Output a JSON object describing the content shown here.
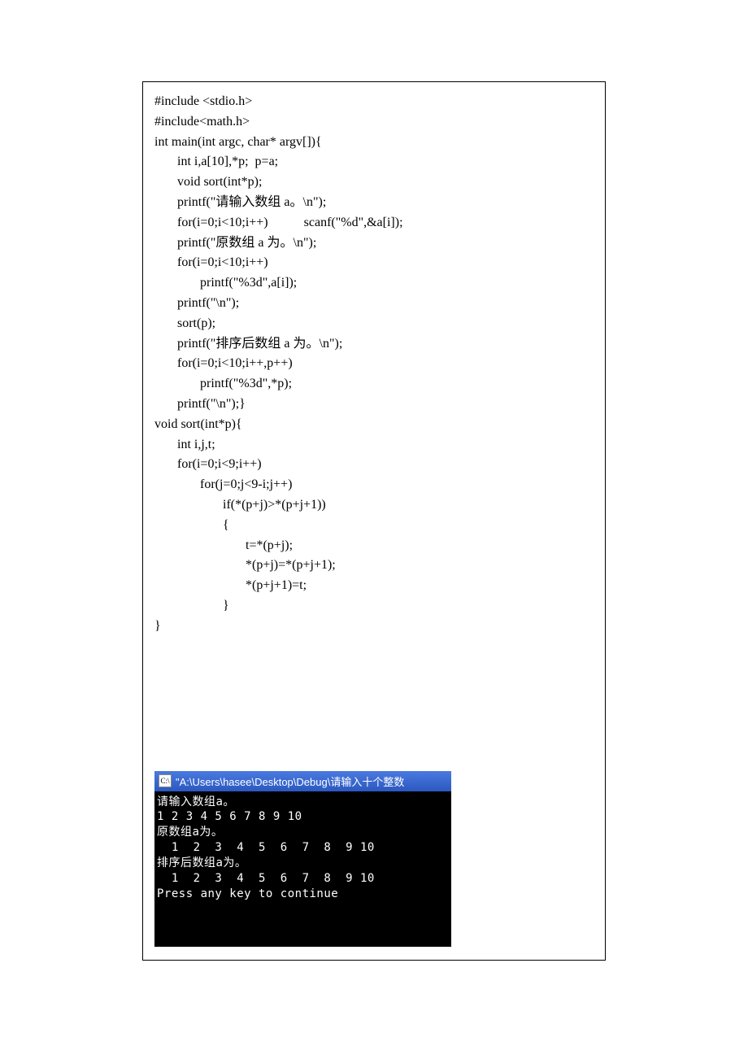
{
  "code": {
    "lines": [
      "#include <stdio.h>",
      "#include<math.h>",
      "int main(int argc, char* argv[]){",
      "       int i,a[10],*p;  p=a;",
      "       void sort(int*p);",
      "       printf(\"请输入数组 a。\\n\");",
      "       for(i=0;i<10;i++)           scanf(\"%d\",&a[i]);",
      "       printf(\"原数组 a 为。\\n\");",
      "       for(i=0;i<10;i++)",
      "              printf(\"%3d\",a[i]);",
      "       printf(\"\\n\");",
      "       sort(p);",
      "       printf(\"排序后数组 a 为。\\n\");",
      "       for(i=0;i<10;i++,p++)",
      "              printf(\"%3d\",*p);",
      "       printf(\"\\n\");}",
      "void sort(int*p){",
      "       int i,j,t;",
      "       for(i=0;i<9;i++)",
      "              for(j=0;j<9-i;j++)",
      "                     if(*(p+j)>*(p+j+1))",
      "                     {",
      "                            t=*(p+j);",
      "                            *(p+j)=*(p+j+1);",
      "                            *(p+j+1)=t;",
      "                     }",
      "}"
    ]
  },
  "console": {
    "icon": "C:\\",
    "path": "\"A:\\Users\\hasee\\Desktop\\Debug\\请输入十个整数",
    "output": "请输入数组a。\n1 2 3 4 5 6 7 8 9 10\n原数组a为。\n  1  2  3  4  5  6  7  8  9 10\n排序后数组a为。\n  1  2  3  4  5  6  7  8  9 10\nPress any key to continue"
  }
}
